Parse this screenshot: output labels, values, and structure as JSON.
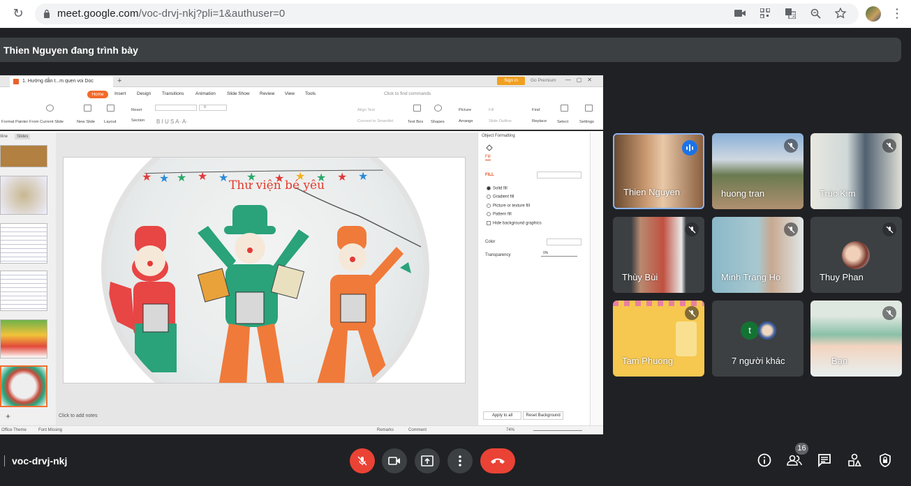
{
  "browser": {
    "url_host": "meet.google.com",
    "url_path": "/voc-drvj-nkj?pli=1&authuser=0"
  },
  "presenter": {
    "text": "Thien Nguyen đang trình bày"
  },
  "shared_app": {
    "tab_title": "1. Hướng dẫn t...m quen voi Doc",
    "sign_in": "Sign in",
    "go_premium": "Go Premium",
    "menu": [
      "Home",
      "Insert",
      "Design",
      "Transitions",
      "Animation",
      "Slide Show",
      "Review",
      "View",
      "Tools"
    ],
    "find_commands": "Click to find commands",
    "ribbon": {
      "format_painter": "Format Painter",
      "from_current_slide": "From Current Slide",
      "new_slide": "New Slide",
      "layout": "Layout",
      "reset": "Reset",
      "section": "Section",
      "font_size": "0",
      "align_text": "Align Text",
      "convert_smartart": "Convert to SmartArt",
      "text_box": "Text Box",
      "shapes": "Shapes",
      "picture": "Picture",
      "arrange": "Arrange",
      "fill": "Fill",
      "slide_outline": "Slide Outline",
      "find": "Find",
      "replace": "Replace",
      "select": "Select",
      "settings": "Settings"
    },
    "pane_tabs": [
      "tline",
      "Slides"
    ],
    "slide_title": "Thư viện bé yêu",
    "notes_placeholder": "Click to add notes",
    "format_panel": {
      "title": "Object Formatting",
      "tab": "Fill",
      "section": "FILL",
      "options": [
        "Solid fill",
        "Gradient fill",
        "Picture or texture fill",
        "Pattern fill"
      ],
      "hide_bg": "Hide background graphics",
      "color_label": "Color",
      "transparency_label": "Transparency",
      "transparency_value": "0%",
      "apply_all": "Apply to all",
      "reset_bg": "Reset Background"
    },
    "status": {
      "theme": "Office Theme",
      "font_missing": "Font Missing",
      "remarks": "Remarks",
      "comment": "Comment",
      "zoom": "74%"
    }
  },
  "participants": [
    {
      "name": "Thien Nguyen",
      "speaking": true
    },
    {
      "name": "huong tran",
      "muted": true
    },
    {
      "name": "Trúc Kim",
      "muted": true
    },
    {
      "name": "Thùy Bùi",
      "muted": true
    },
    {
      "name": "Minh Trang Ho",
      "muted": true
    },
    {
      "name": "Thuy Phan",
      "muted": true
    },
    {
      "name": "Tam Phuong",
      "muted": true
    },
    {
      "name": "7 người khác",
      "avatar_letter": "t"
    },
    {
      "name": "Bạn",
      "muted": true
    }
  ],
  "bottom": {
    "meeting_code": "voc-drvj-nkj",
    "people_count": "16"
  },
  "colors": {
    "background": "#202124",
    "hangup": "#ea4335",
    "speaking": "#1a73e8",
    "wps_accent": "#f26a2a"
  }
}
